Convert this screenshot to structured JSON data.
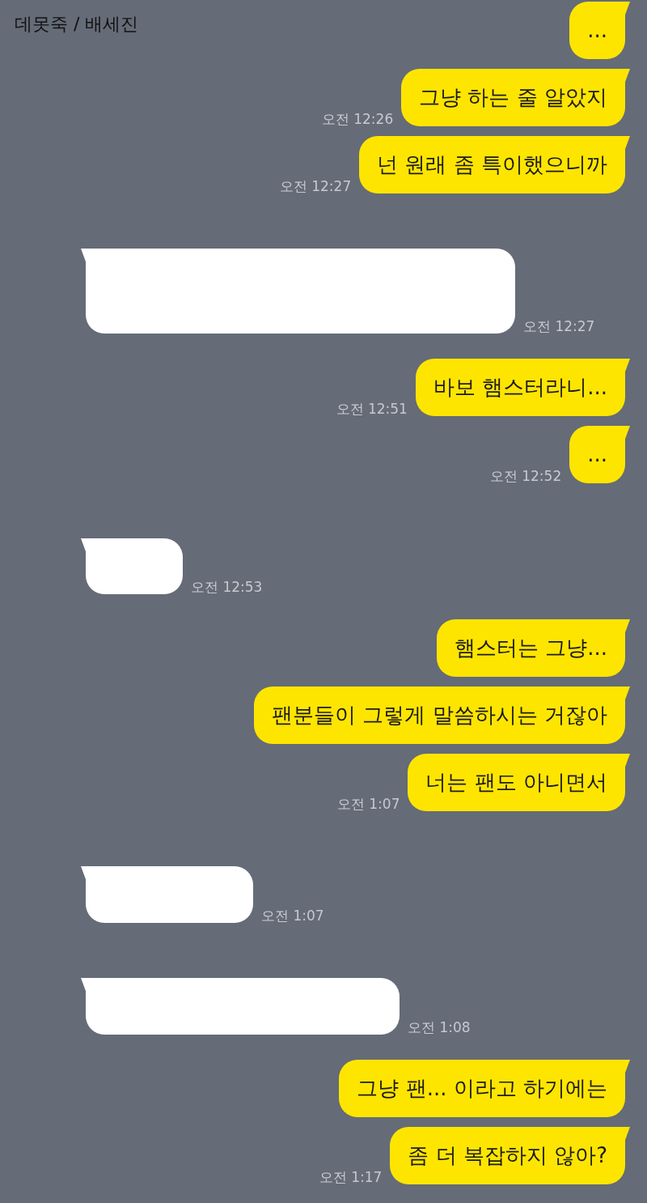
{
  "header": {
    "title": "데못죽 / 배세진"
  },
  "messages": [
    {
      "kind": "sent",
      "text": "..."
    },
    {
      "kind": "sent",
      "text": "그냥 하는 줄 알았지",
      "time": "오전 12:26"
    },
    {
      "kind": "sent",
      "text": "넌 원래 좀 특이했으니까",
      "time": "오전 12:27"
    },
    {
      "kind": "received",
      "time": "오전 12:27"
    },
    {
      "kind": "sent",
      "text": "바보 햄스터라니...",
      "time": "오전 12:51"
    },
    {
      "kind": "sent",
      "text": "...",
      "time": "오전 12:52"
    },
    {
      "kind": "received",
      "time": "오전 12:53"
    },
    {
      "kind": "sent",
      "text": "햄스터는 그냥..."
    },
    {
      "kind": "sent",
      "text": "팬분들이 그렇게 말씀하시는 거잖아"
    },
    {
      "kind": "sent",
      "text": "너는 팬도 아니면서",
      "time": "오전 1:07"
    },
    {
      "kind": "received",
      "time": "오전 1:07"
    },
    {
      "kind": "received",
      "time": "오전 1:08"
    },
    {
      "kind": "sent",
      "text": "그냥 팬... 이라고 하기에는"
    },
    {
      "kind": "sent",
      "text": "좀 더 복잡하지 않아?",
      "time": "오전 1:17"
    }
  ]
}
